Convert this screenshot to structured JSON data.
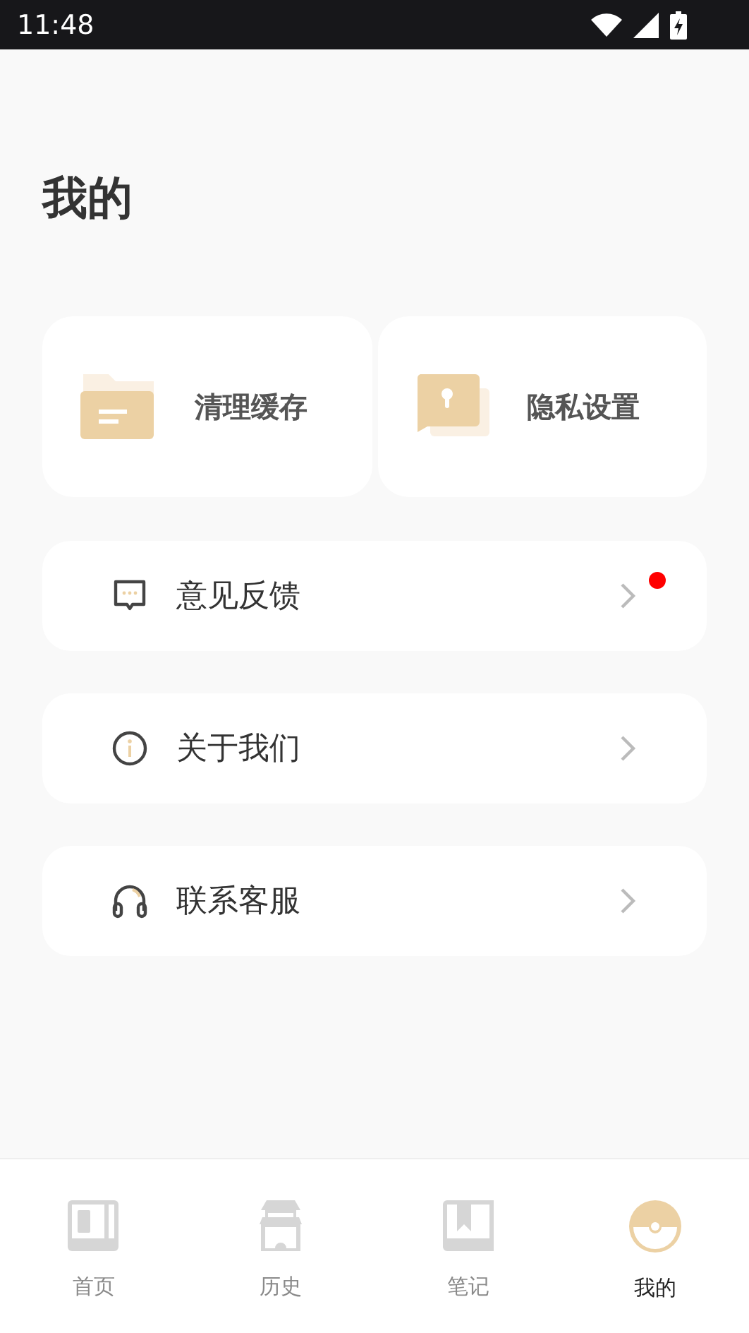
{
  "status_bar": {
    "time": "11:48"
  },
  "page_title": "我的",
  "quick_actions": [
    {
      "label": "清理缓存",
      "kind": "folder"
    },
    {
      "label": "隐私设置",
      "kind": "lock"
    }
  ],
  "menu": [
    {
      "label": "意见反馈",
      "kind": "message",
      "badge": true
    },
    {
      "label": "关于我们",
      "kind": "info",
      "badge": false
    },
    {
      "label": "联系客服",
      "kind": "headset",
      "badge": false
    }
  ],
  "tabs": [
    {
      "label": "首页",
      "kind": "home",
      "selected": false
    },
    {
      "label": "历史",
      "kind": "history",
      "selected": false
    },
    {
      "label": "笔记",
      "kind": "notes",
      "selected": false
    },
    {
      "label": "我的",
      "kind": "profile",
      "selected": true
    }
  ]
}
